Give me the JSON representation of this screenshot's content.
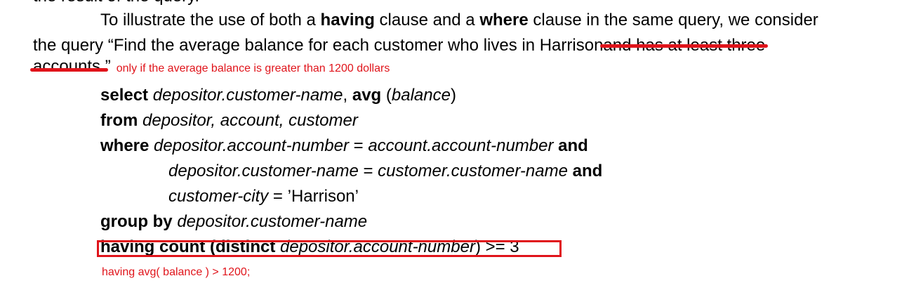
{
  "doc": {
    "cut_line": "the result of the query.",
    "para1": {
      "prefix": "To illustrate the use of both a ",
      "kw1": "having",
      "mid": " clause and a ",
      "kw2": "where",
      "suffix": " clause in the same query, we consider"
    },
    "para2": {
      "text": "the query “Find the average balance for each customer who lives in Harrison",
      "struck": " and has at least three"
    },
    "para3": {
      "struck": "accounts.",
      "close_quote": "”",
      "annotation": "only if the average balance is greater than 1200 dollars"
    },
    "code": {
      "line1": {
        "kw": "select ",
        "a": "depositor.customer-name",
        "b": ", ",
        "kw2": "avg",
        "c": " (",
        "d": "balance",
        "e": ")"
      },
      "line2": {
        "kw": "from ",
        "a": "depositor, account, customer"
      },
      "line3": {
        "kw": "where ",
        "a": "depositor.account-number",
        "b": " = ",
        "c": "account.account-number",
        "kw2": " and"
      },
      "line4": {
        "a": "depositor.customer-name",
        "b": " = ",
        "c": "customer.customer-name",
        "kw2": " and"
      },
      "line5": {
        "a": "customer-city",
        "b": " = ’Harrison’"
      },
      "line6": {
        "kw": "group by ",
        "a": "depositor.customer-name"
      },
      "line7": {
        "kw": "having count (distinct ",
        "a": "depositor.account-number",
        "b": ") >= 3"
      }
    },
    "replacement_note": "having avg( balance ) > 1200;"
  },
  "colors": {
    "annotation_red": "#e0141b",
    "text": "#000000"
  }
}
